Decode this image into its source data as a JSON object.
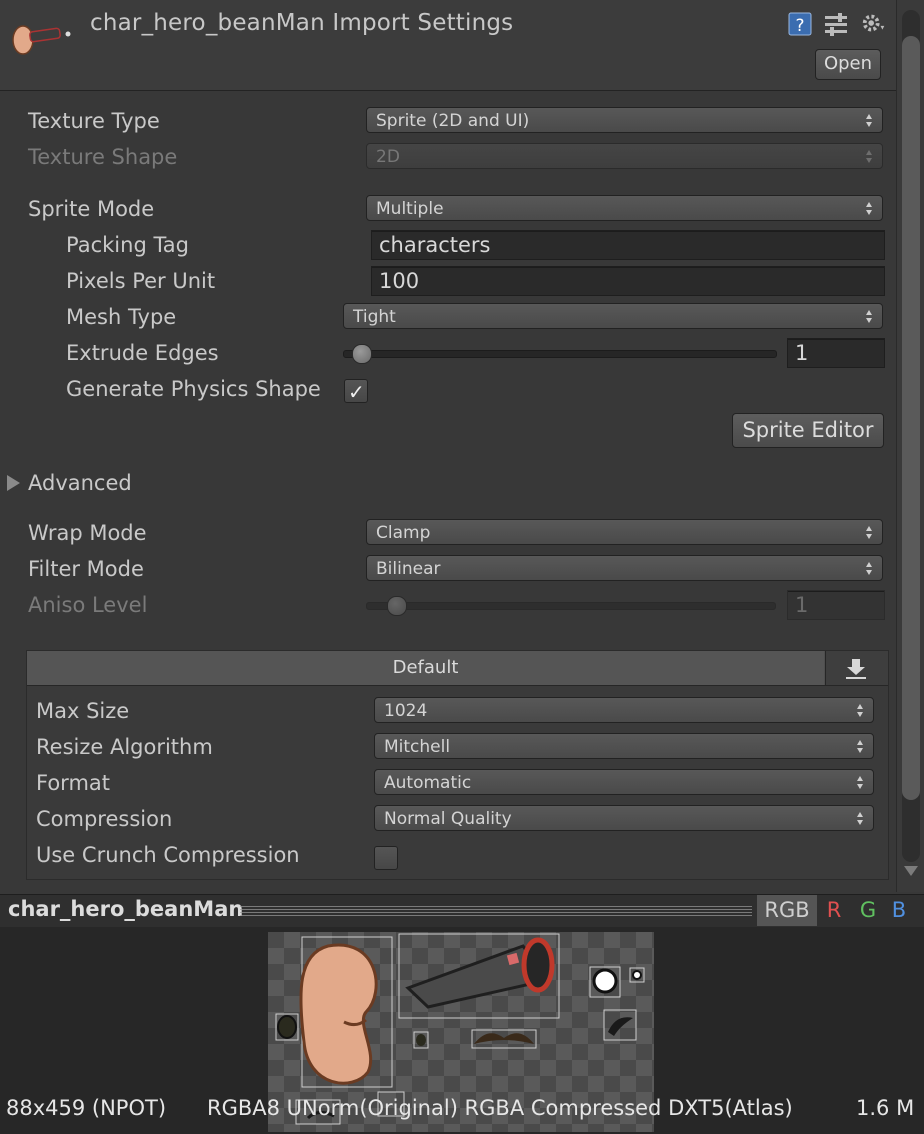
{
  "header": {
    "title": "char_hero_beanMan Import Settings",
    "open_label": "Open",
    "icons": [
      "asset-thumbnail-icon",
      "help-icon",
      "preset-icon",
      "gear-icon"
    ]
  },
  "settings": {
    "texture_type": {
      "label": "Texture Type",
      "value": "Sprite (2D and UI)"
    },
    "texture_shape": {
      "label": "Texture Shape",
      "value": "2D"
    },
    "sprite_mode": {
      "label": "Sprite Mode",
      "value": "Multiple"
    },
    "packing_tag": {
      "label": "Packing Tag",
      "value": "characters"
    },
    "pixels_per_unit": {
      "label": "Pixels Per Unit",
      "value": "100"
    },
    "mesh_type": {
      "label": "Mesh Type",
      "value": "Tight"
    },
    "extrude_edges": {
      "label": "Extrude Edges",
      "value": "1",
      "slider_fraction": 0.0
    },
    "generate_physics_shape": {
      "label": "Generate Physics Shape",
      "checked": true
    },
    "sprite_editor_label": "Sprite Editor",
    "advanced_label": "Advanced",
    "wrap_mode": {
      "label": "Wrap Mode",
      "value": "Clamp"
    },
    "filter_mode": {
      "label": "Filter Mode",
      "value": "Bilinear"
    },
    "aniso_level": {
      "label": "Aniso Level",
      "value": "1",
      "slider_fraction": 0.08
    }
  },
  "platform": {
    "tab_label": "Default",
    "download_icon": "download-icon",
    "max_size": {
      "label": "Max Size",
      "value": "1024"
    },
    "resize_algorithm": {
      "label": "Resize Algorithm",
      "value": "Mitchell"
    },
    "format": {
      "label": "Format",
      "value": "Automatic"
    },
    "compression": {
      "label": "Compression",
      "value": "Normal Quality"
    },
    "use_crunch": {
      "label": "Use Crunch Compression",
      "checked": false
    }
  },
  "preview": {
    "name": "char_hero_beanMan",
    "channels": [
      "RGB",
      "R",
      "G",
      "B"
    ],
    "channel_colors": {
      "RGB": "#c8c8c8",
      "R": "#e05050",
      "G": "#60c060",
      "B": "#5090e0"
    },
    "info_size": "88x459 (NPOT)",
    "info_format": "RGBA8 UNorm(Original) RGBA Compressed DXT5(Atlas)",
    "info_memory": "1.6 M"
  },
  "colors": {
    "background": "#383838",
    "bean": "#e2a98a",
    "cannon": "#4a4a4a",
    "cannon_rim": "#c0392b"
  }
}
